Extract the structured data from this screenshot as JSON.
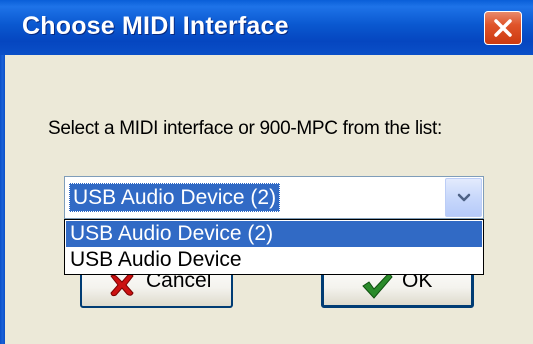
{
  "window": {
    "title": "Choose MIDI Interface"
  },
  "dialog": {
    "prompt": "Select a MIDI interface or 900-MPC from the list:"
  },
  "interface_select": {
    "selected_value": "USB Audio Device (2)",
    "options": [
      {
        "label": "USB Audio Device (2)",
        "highlighted": true
      },
      {
        "label": "USB Audio Device",
        "highlighted": false
      }
    ]
  },
  "buttons": {
    "cancel_label": "Cancel",
    "ok_label": "OK"
  },
  "icons": {
    "close": "close-icon",
    "dropdown": "chevron-down-icon",
    "cancel": "red-x-icon",
    "ok": "green-checkmark-icon"
  },
  "colors": {
    "titlebar": "#0a58d0",
    "selection": "#316ac5",
    "dialog_bg": "#ece9d8",
    "close_button": "#e0542a",
    "cancel_icon": "#cc1111",
    "ok_icon": "#2a8a2a"
  }
}
